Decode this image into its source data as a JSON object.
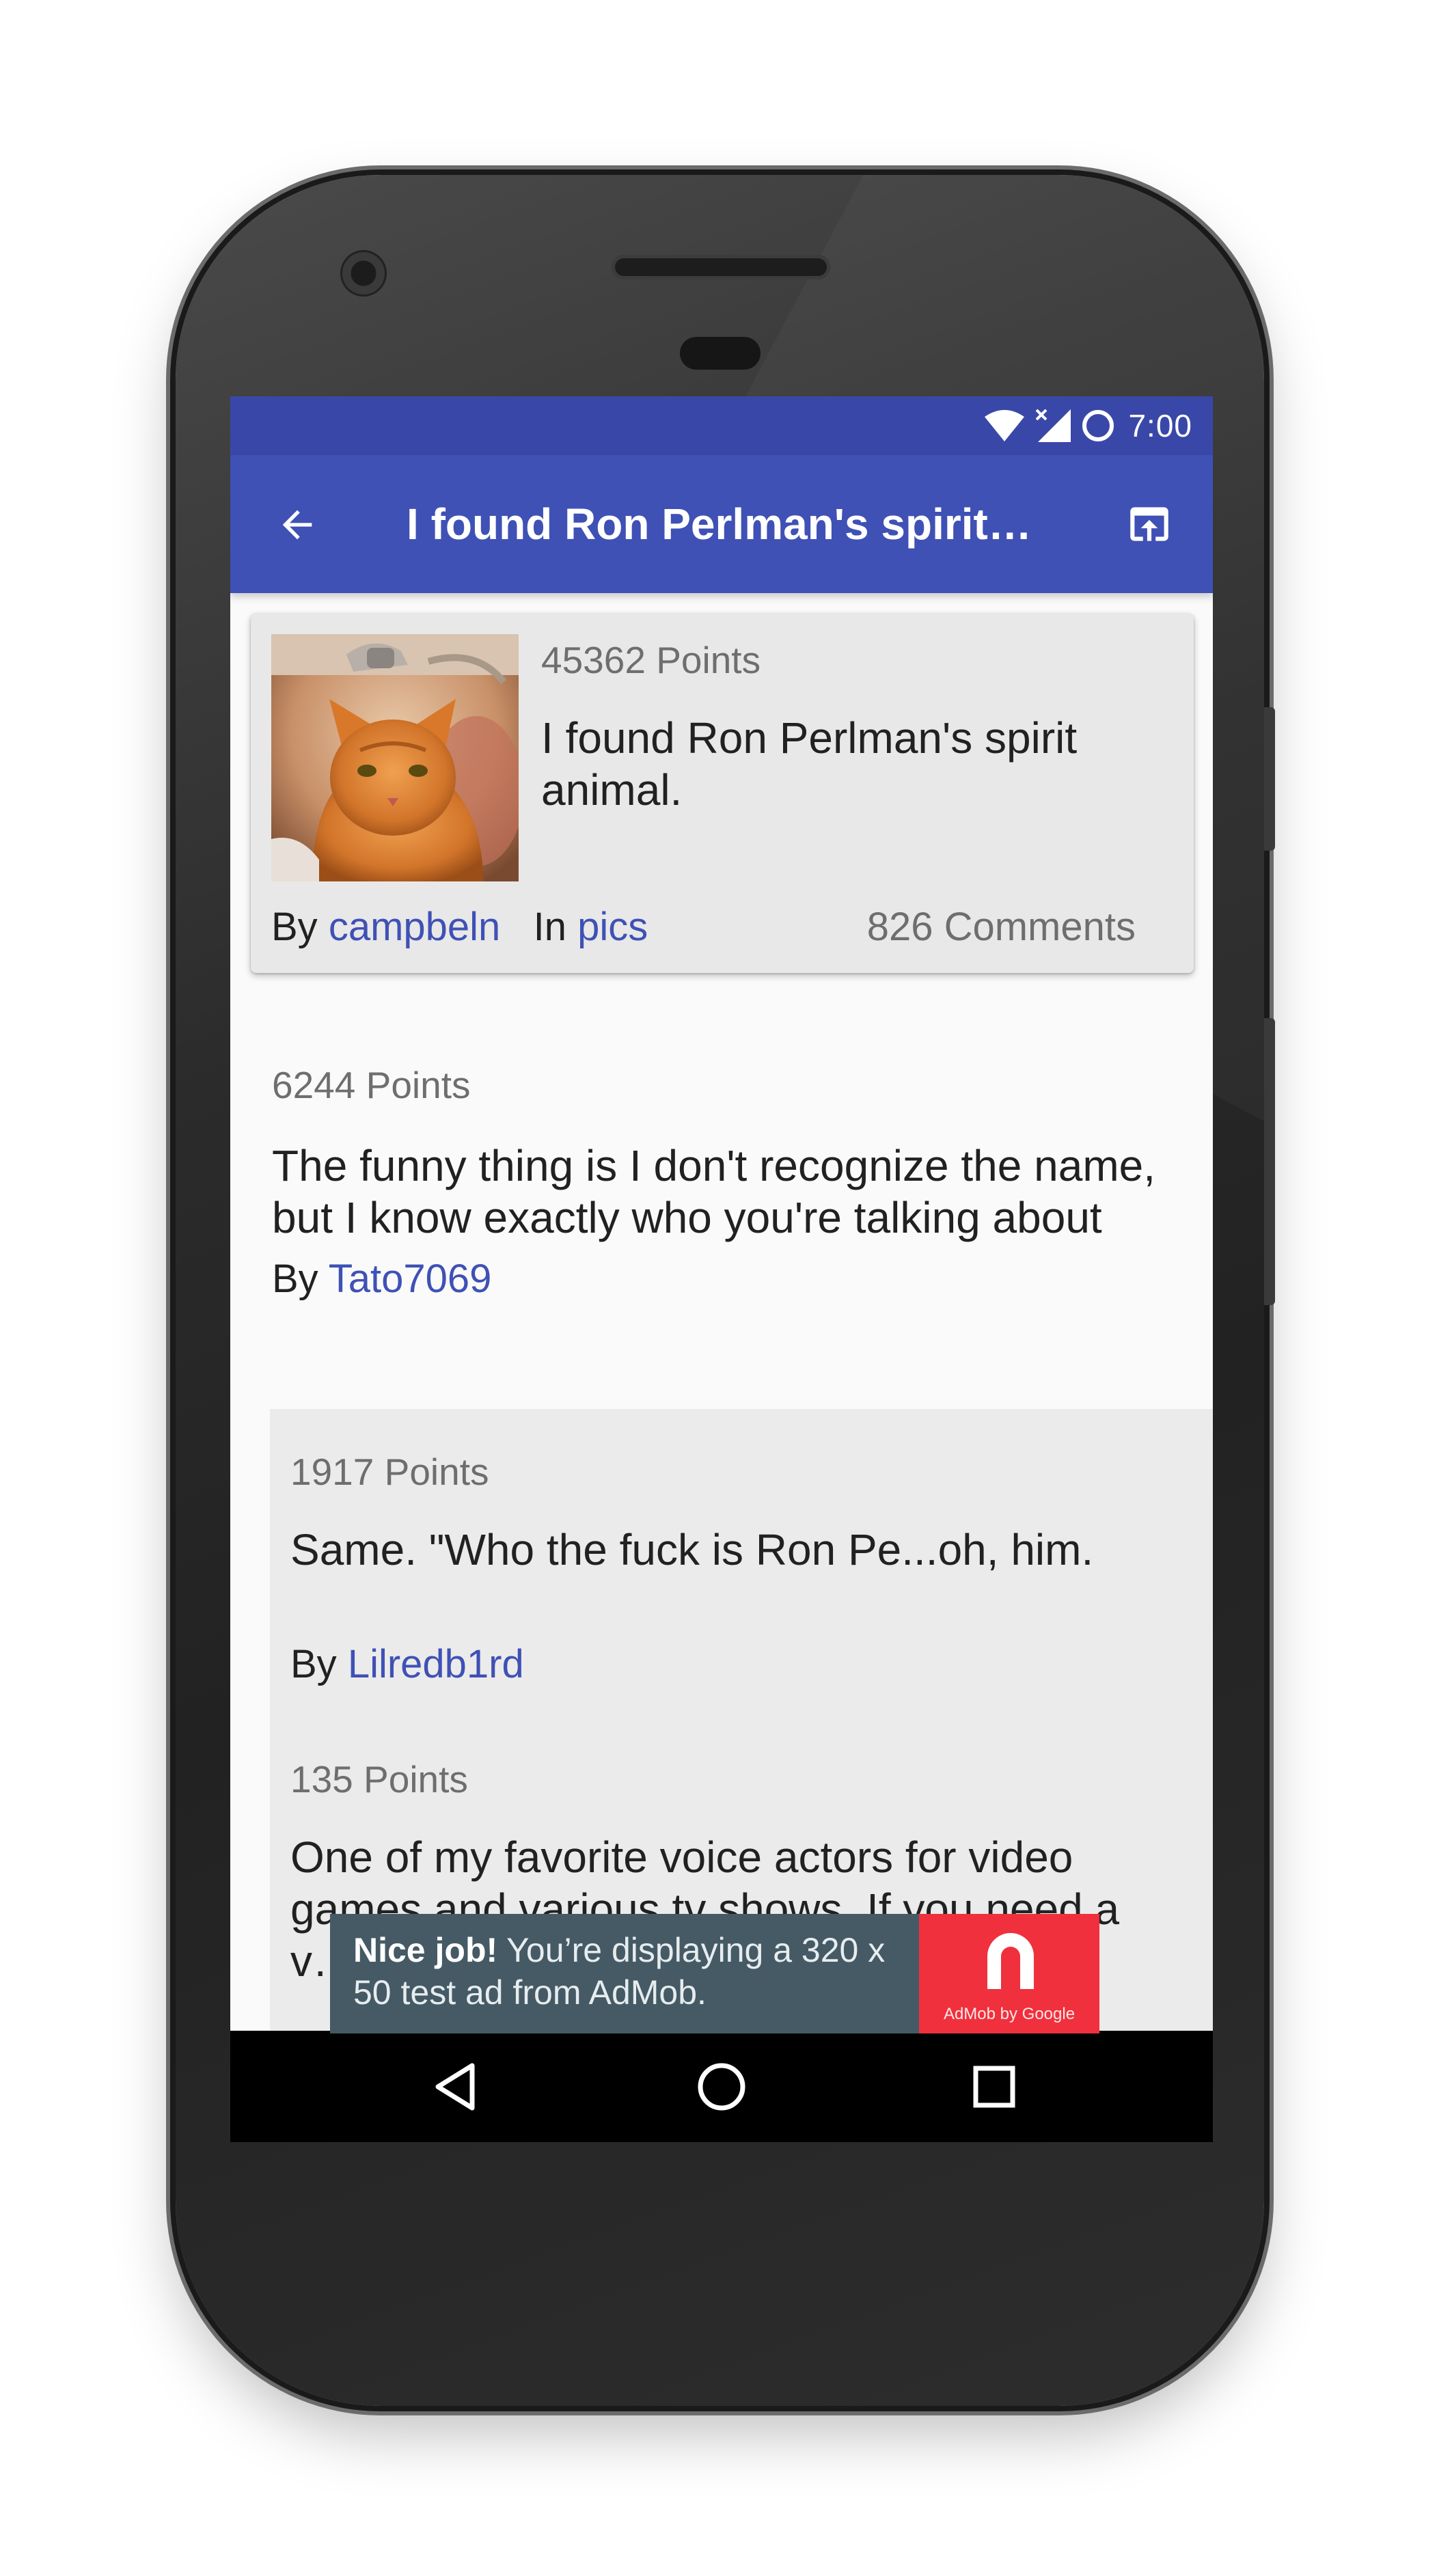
{
  "status_bar": {
    "time": "7:00",
    "icons": [
      "wifi-icon",
      "cell-signal-icon",
      "battery-circle-icon"
    ]
  },
  "app_bar": {
    "title": "I found Ron Perlman's spirit…",
    "back_icon": "arrow-back-icon",
    "open_icon": "open-in-browser-icon",
    "color": "#3f51b5",
    "status_color": "#3948a8"
  },
  "post": {
    "points": "45362 Points",
    "title": "I found Ron Perlman's spirit animal.",
    "by_label": "By",
    "author": "campbeln",
    "in_label": "In",
    "subreddit": "pics",
    "comments": "826 Comments",
    "thumbnail": "orange-cat-photo"
  },
  "comments": [
    {
      "points": "6244 Points",
      "body": "The funny thing is I don't recognize the name, but I know exactly who you're talking about",
      "by_label": "By",
      "author": "Tato7069"
    }
  ],
  "replies": [
    {
      "points": "1917 Points",
      "body": "Same. \"Who the fuck is Ron Pe...oh, him.",
      "by_label": "By",
      "author": "Lilredb1rd"
    },
    {
      "points": "135 Points",
      "body": "One of my favorite voice actors for video games and various tv shows. If you need a v…"
    }
  ],
  "ad": {
    "bold": "Nice job!",
    "text": "You’re displaying a 320 x 50 test ad from AdMob.",
    "logo_caption": "AdMob by Google",
    "background": "#455a64",
    "logo_color": "#f0303c"
  },
  "nav": {
    "icons": [
      "nav-back-icon",
      "nav-home-icon",
      "nav-recents-icon"
    ]
  },
  "colors": {
    "link": "#3f51b5",
    "card_bg": "#e8e8e8",
    "reply_bg": "#ebebeb"
  }
}
